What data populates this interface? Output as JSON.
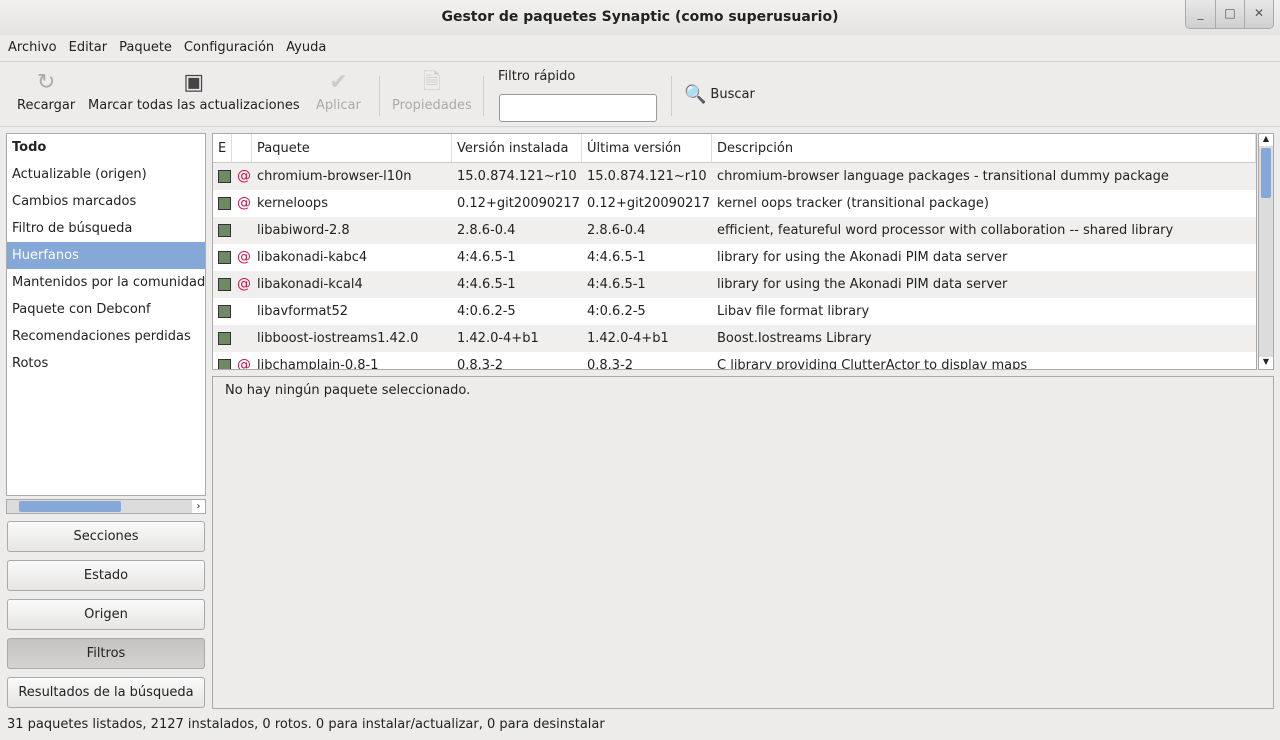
{
  "window": {
    "title": "Gestor de paquetes Synaptic  (como superusuario)"
  },
  "menu": [
    "Archivo",
    "Editar",
    "Paquete",
    "Configuración",
    "Ayuda"
  ],
  "toolbar": {
    "reload": "Recargar",
    "mark_all": "Marcar todas las actualizaciones",
    "apply": "Aplicar",
    "properties": "Propiedades",
    "quick_filter_label": "Filtro rápido",
    "quick_filter_value": "",
    "search": "Buscar"
  },
  "filters": {
    "items": [
      "Todo",
      "Actualizable (origen)",
      "Cambios marcados",
      "Filtro de búsqueda",
      "Huerfanos",
      "Mantenidos por la comunidad",
      "Paquete con Debconf",
      "Recomendaciones perdidas",
      "Rotos"
    ],
    "selected": "Huerfanos"
  },
  "view_buttons": [
    "Secciones",
    "Estado",
    "Origen",
    "Filtros",
    "Resultados de la búsqueda"
  ],
  "table": {
    "headers": [
      "E",
      "",
      "Paquete",
      "Versión instalada",
      "Última versión",
      "Descripción"
    ],
    "rows": [
      {
        "name": "chromium-browser-l10n",
        "installed": "15.0.874.121~r10",
        "latest": "15.0.874.121~r10",
        "desc": "chromium-browser language packages - transitional dummy package",
        "debian": true
      },
      {
        "name": "kerneloops",
        "installed": "0.12+git20090217",
        "latest": "0.12+git20090217",
        "desc": "kernel oops tracker (transitional package)",
        "debian": true
      },
      {
        "name": "libabiword-2.8",
        "installed": "2.8.6-0.4",
        "latest": "2.8.6-0.4",
        "desc": "efficient, featureful word processor with collaboration -- shared library",
        "debian": false
      },
      {
        "name": "libakonadi-kabc4",
        "installed": "4:4.6.5-1",
        "latest": "4:4.6.5-1",
        "desc": "library for using the Akonadi PIM data server",
        "debian": true
      },
      {
        "name": "libakonadi-kcal4",
        "installed": "4:4.6.5-1",
        "latest": "4:4.6.5-1",
        "desc": "library for using the Akonadi PIM data server",
        "debian": true
      },
      {
        "name": "libavformat52",
        "installed": "4:0.6.2-5",
        "latest": "4:0.6.2-5",
        "desc": "Libav file format library",
        "debian": false
      },
      {
        "name": "libboost-iostreams1.42.0",
        "installed": "1.42.0-4+b1",
        "latest": "1.42.0-4+b1",
        "desc": "Boost.Iostreams Library",
        "debian": false
      },
      {
        "name": "libchamplain-0.8-1",
        "installed": "0.8.3-2",
        "latest": "0.8.3-2",
        "desc": "C library providing ClutterActor to display maps",
        "debian": true
      }
    ]
  },
  "detail": "No hay ningún paquete seleccionado.",
  "status": "31 paquetes listados, 2127 instalados, 0 rotos. 0 para instalar/actualizar, 0 para desinstalar"
}
